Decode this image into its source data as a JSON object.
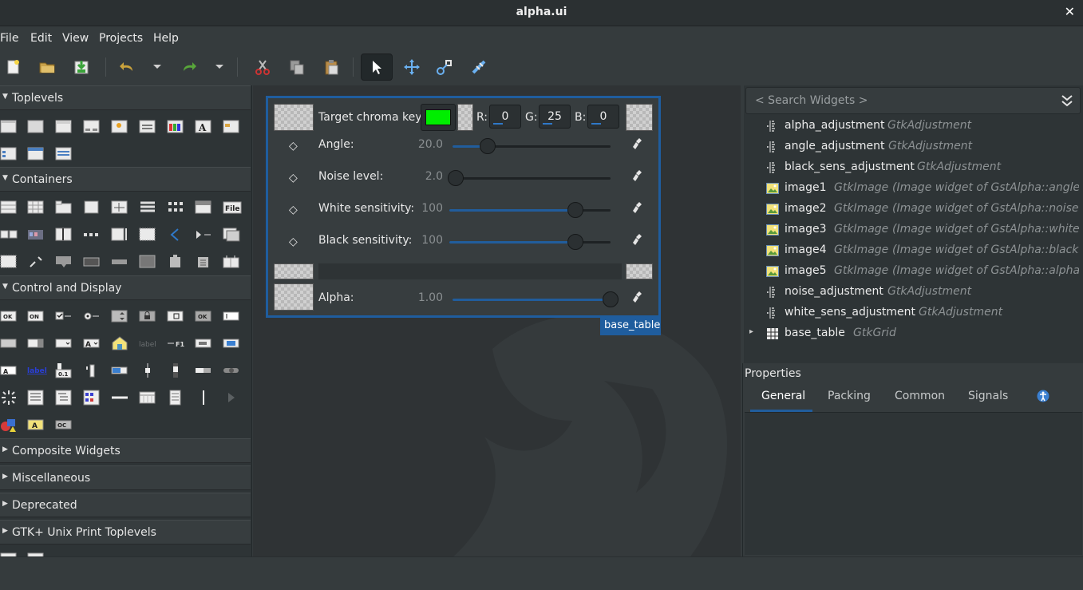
{
  "window": {
    "title": "alpha.ui",
    "close": "✕"
  },
  "menu": [
    "File",
    "Edit",
    "View",
    "Projects",
    "Help"
  ],
  "palette": {
    "sections": [
      {
        "label": "Toplevels",
        "expanded": true
      },
      {
        "label": "Containers",
        "expanded": true
      },
      {
        "label": "Control and Display",
        "expanded": true
      },
      {
        "label": "Composite Widgets",
        "expanded": false
      },
      {
        "label": "Miscellaneous",
        "expanded": false
      },
      {
        "label": "Deprecated",
        "expanded": false
      },
      {
        "label": "GTK+ Unix Print Toplevels",
        "expanded": false
      }
    ],
    "icon_texts": {
      "file": "File",
      "ok": "OK",
      "on": "ON",
      "label": "label",
      "a": "A",
      "f1": "F1",
      "zero": "0.1"
    }
  },
  "canvas": {
    "frame_label": "base_table",
    "chroma": {
      "label": "Target chroma key:",
      "color": "#00ee00",
      "r_label": "R:",
      "r": "0",
      "g_label": "G:",
      "g": "25",
      "b_label": "B:",
      "b": "0"
    },
    "sliders": [
      {
        "label": "Angle:",
        "value": "20.0",
        "fraction": 0.22
      },
      {
        "label": "Noise level:",
        "value": "2.0",
        "fraction": 0.02
      },
      {
        "label": "White sensitivity:",
        "value": "100",
        "fraction": 0.78
      },
      {
        "label": "Black sensitivity:",
        "value": "100",
        "fraction": 0.78
      }
    ],
    "alpha": {
      "label": "Alpha:",
      "value": "1.00",
      "fraction": 1.0
    }
  },
  "tree": {
    "search_placeholder": "< Search Widgets >",
    "rows": [
      {
        "name": "alpha_adjustment",
        "type": "GtkAdjustment",
        "icon": "adjustment-icon"
      },
      {
        "name": "angle_adjustment",
        "type": "GtkAdjustment",
        "icon": "adjustment-icon"
      },
      {
        "name": "black_sens_adjustment",
        "type": "GtkAdjustment",
        "icon": "adjustment-icon"
      },
      {
        "name": "image1",
        "type": "GtkImage",
        "desc": "(Image widget of GstAlpha::angle::...",
        "icon": "image-icon"
      },
      {
        "name": "image2",
        "type": "GtkImage",
        "desc": "(Image widget of GstAlpha::noise-l...",
        "icon": "image-icon"
      },
      {
        "name": "image3",
        "type": "GtkImage",
        "desc": "(Image widget of GstAlpha::white-...",
        "icon": "image-icon"
      },
      {
        "name": "image4",
        "type": "GtkImage",
        "desc": "(Image widget of GstAlpha::black-s...",
        "icon": "image-icon"
      },
      {
        "name": "image5",
        "type": "GtkImage",
        "desc": "(Image widget of GstAlpha::alpha::r...",
        "icon": "image-icon"
      },
      {
        "name": "noise_adjustment",
        "type": "GtkAdjustment",
        "icon": "adjustment-icon"
      },
      {
        "name": "white_sens_adjustment",
        "type": "GtkAdjustment",
        "icon": "adjustment-icon"
      },
      {
        "name": "base_table",
        "type": "GtkGrid",
        "icon": "grid-icon",
        "expander": "▸"
      }
    ]
  },
  "properties": {
    "title": "Properties",
    "tabs": [
      "General",
      "Packing",
      "Common",
      "Signals"
    ],
    "active_tab": "General"
  },
  "colors": {
    "accent": "#215d9c",
    "frame_border": "#1f5d9e"
  }
}
